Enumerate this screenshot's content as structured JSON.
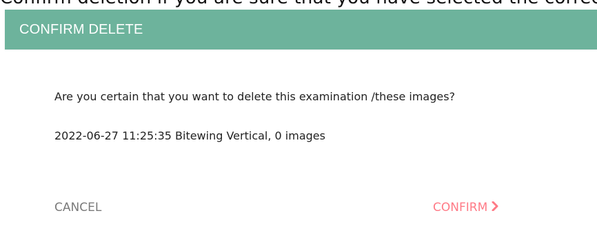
{
  "background_instruction": "Confirm deletion if you are sure that you have selected the correct",
  "dialog": {
    "title": "CONFIRM DELETE",
    "message": "Are you certain that you want to delete this examination /these images?",
    "details": "2022-06-27 11:25:35 Bitewing Vertical, 0 images",
    "cancel_label": "CANCEL",
    "confirm_label": "CONFIRM",
    "confirm_icon": "chevron-right-icon"
  },
  "colors": {
    "header": "#6db39c",
    "confirm": "#ff7a86",
    "cancel": "#7a7a7a",
    "text": "#222222"
  }
}
